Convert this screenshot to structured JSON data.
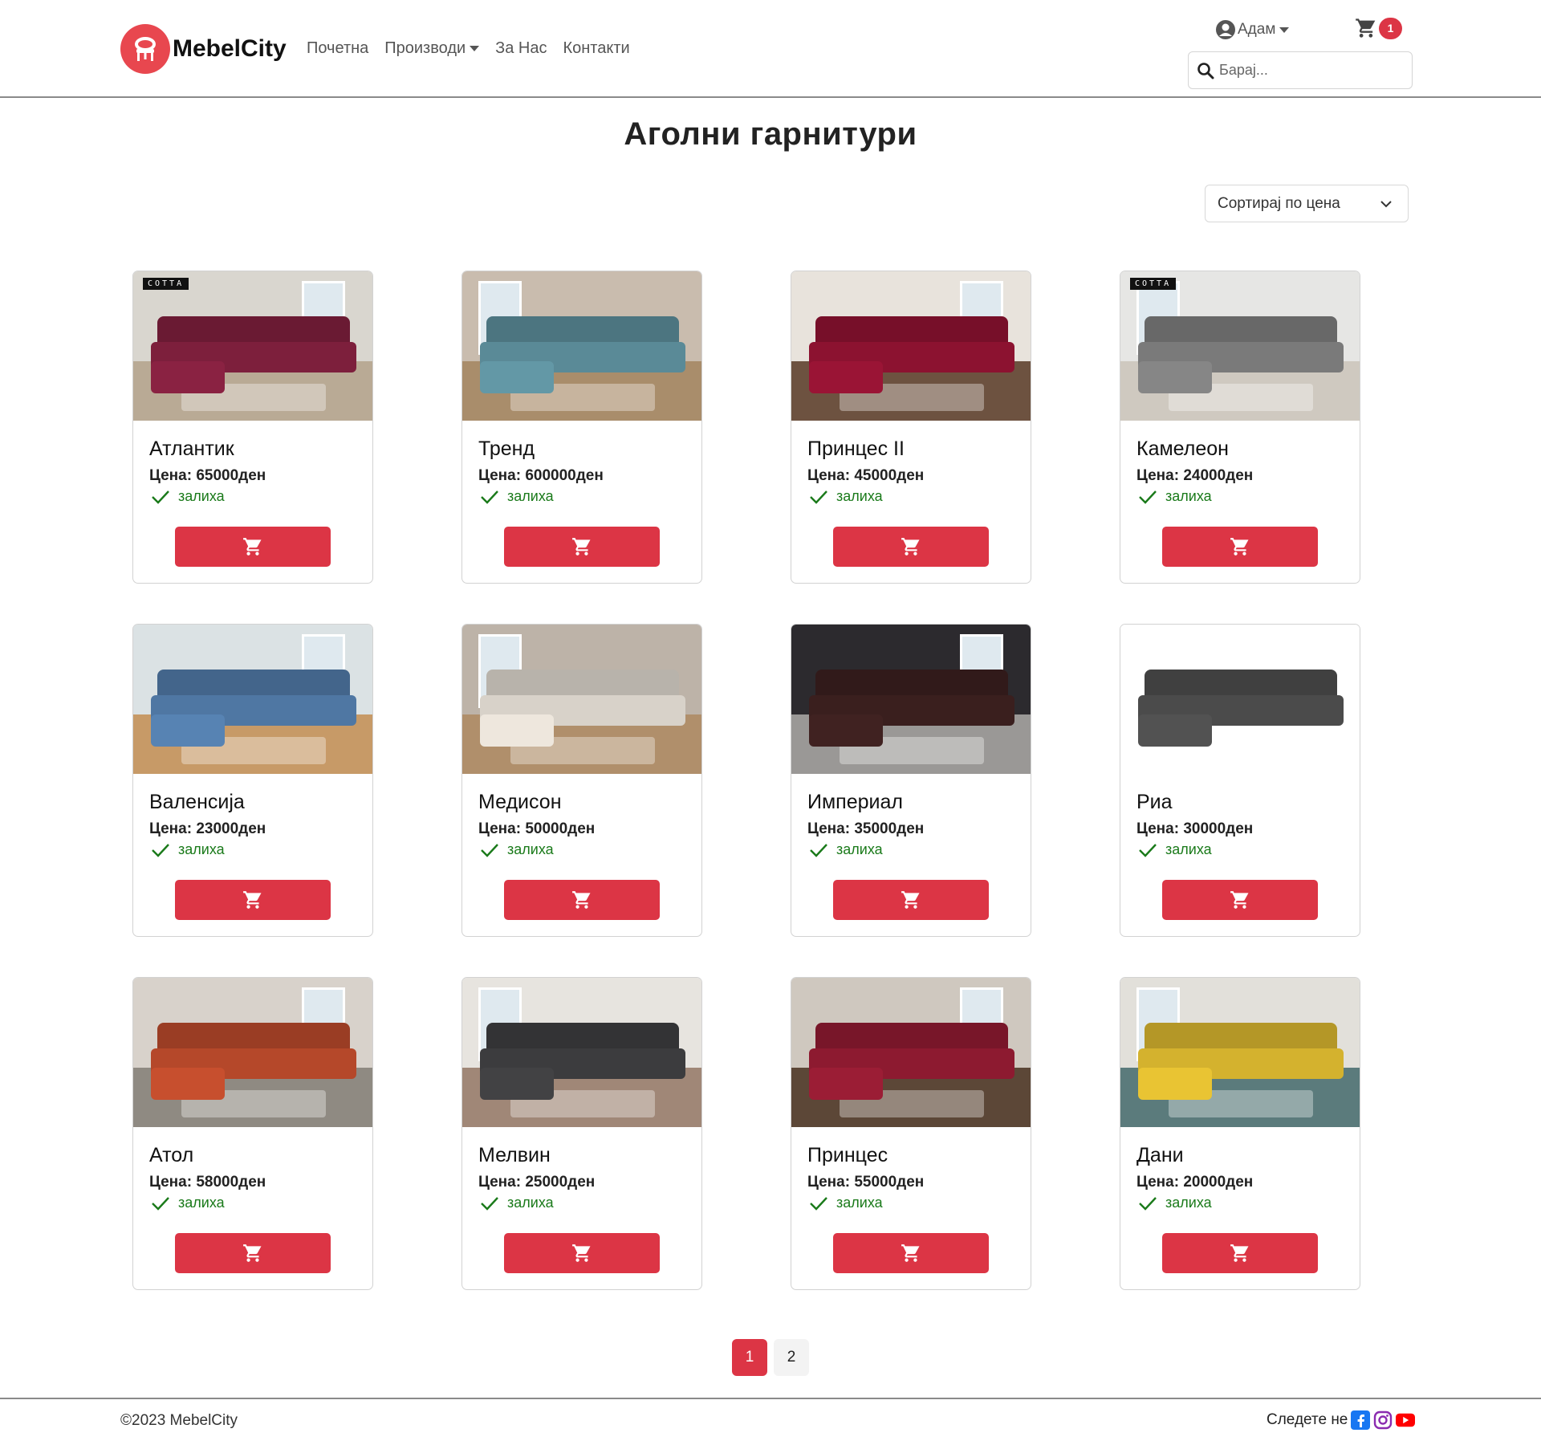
{
  "brand": {
    "name": "MebelCity",
    "accent": "#dc3545",
    "logo_color": "#e8474f"
  },
  "nav": {
    "items": [
      {
        "label": "Почетна"
      },
      {
        "label": "Производи",
        "dropdown": true
      },
      {
        "label": "За Нас"
      },
      {
        "label": "Контакти"
      }
    ]
  },
  "user": {
    "name": "Адам",
    "icon": "user-circle-icon"
  },
  "cart": {
    "count": "1",
    "icon": "cart-icon"
  },
  "search": {
    "placeholder": "Барај...",
    "icon": "search-icon"
  },
  "page": {
    "title": "Аголни гарнитури"
  },
  "sort": {
    "selected": "Сортирај по цена"
  },
  "products": [
    {
      "name": "Атлантик",
      "price": "Цена: 65000ден",
      "stock": "залиха",
      "sofa_color": "#7d1f3c",
      "wall": "#d9d6cf",
      "floor": "#b9aa95",
      "tag": "COTTA"
    },
    {
      "name": "Тренд",
      "price": "Цена: 600000ден",
      "stock": "залиха",
      "sofa_color": "#5a8a97",
      "wall": "#c9bcae",
      "floor": "#a98d6b",
      "tag": ""
    },
    {
      "name": "Принцес II",
      "price": "Цена: 45000ден",
      "stock": "залиха",
      "sofa_color": "#8c1230",
      "wall": "#e8e3dc",
      "floor": "#6d5240",
      "tag": ""
    },
    {
      "name": "Камелеон",
      "price": "Цена: 24000ден",
      "stock": "залиха",
      "sofa_color": "#7a7a7a",
      "wall": "#e6e6e4",
      "floor": "#cfc9c0",
      "tag": "COTTA"
    },
    {
      "name": "Валенсија",
      "price": "Цена: 23000ден",
      "stock": "залиха",
      "sofa_color": "#4f77a3",
      "wall": "#dbe2e4",
      "floor": "#c79a67",
      "tag": ""
    },
    {
      "name": "Медисон",
      "price": "Цена: 50000ден",
      "stock": "залиха",
      "sofa_color": "#d8d2c9",
      "wall": "#bdb3a8",
      "floor": "#b08f6b",
      "tag": ""
    },
    {
      "name": "Империал",
      "price": "Цена: 35000ден",
      "stock": "залиха",
      "sofa_color": "#3a1f1e",
      "wall": "#2c2a2e",
      "floor": "#9a9896",
      "tag": ""
    },
    {
      "name": "Риа",
      "price": "Цена: 30000ден",
      "stock": "залиха",
      "sofa_color": "#4b4b4b",
      "wall": "#ffffff",
      "floor": "#ffffff",
      "tag": ""
    },
    {
      "name": "Атол",
      "price": "Цена: 58000ден",
      "stock": "залиха",
      "sofa_color": "#b5482a",
      "wall": "#d8d2cb",
      "floor": "#8f8a82",
      "tag": ""
    },
    {
      "name": "Мелвин",
      "price": "Цена: 25000ден",
      "stock": "залиха",
      "sofa_color": "#3c3c3e",
      "wall": "#e7e4df",
      "floor": "#a08777",
      "tag": ""
    },
    {
      "name": "Принцес",
      "price": "Цена: 55000ден",
      "stock": "залиха",
      "sofa_color": "#8d1a30",
      "wall": "#cfc8bf",
      "floor": "#5c4737",
      "tag": ""
    },
    {
      "name": "Дани",
      "price": "Цена: 20000ден",
      "stock": "залиха",
      "sofa_color": "#d4b22e",
      "wall": "#e2e0da",
      "floor": "#5b7b7c",
      "tag": ""
    }
  ],
  "pagination": {
    "pages": [
      "1",
      "2"
    ],
    "active": "1"
  },
  "footer": {
    "copyright": "©2023 MebelCity",
    "follow": "Следете не",
    "social": [
      {
        "icon": "facebook-icon",
        "color": "#1877f2"
      },
      {
        "icon": "instagram-icon",
        "color": "#8a2bb0"
      },
      {
        "icon": "youtube-icon",
        "color": "#ff0000"
      }
    ]
  }
}
